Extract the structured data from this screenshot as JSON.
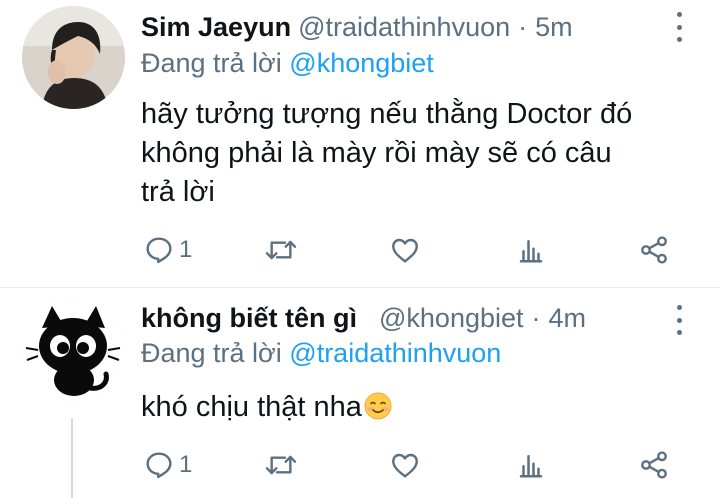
{
  "tweets": [
    {
      "name": "Sim Jaeyun",
      "handle": "@traidathinhvuon",
      "dot": "·",
      "time": "5m",
      "reply_prefix": "Đang trả lời",
      "reply_mention": "@khongbiet",
      "lines": [
        "hãy tưởng tượng nếu thằng Doctor đó",
        "không phải là mày rồi mày sẽ có câu",
        "trả lời"
      ],
      "reply_count": "1"
    },
    {
      "name": "không biết tên gì",
      "handle": "@khongbiet",
      "dot": "·",
      "time": "4m",
      "reply_prefix": "Đang trả lời",
      "reply_mention": "@traidathinhvuon",
      "lines": [
        "khó chịu thật nha"
      ],
      "reply_count": "1"
    }
  ],
  "icons": {
    "reply": "reply-icon",
    "retweet": "retweet-icon",
    "like": "heart-icon",
    "analytics": "analytics-icon",
    "share": "share-icon",
    "more": "more-vertical-icon",
    "emoji": "smiling-face-emoji"
  },
  "colors": {
    "accent": "#1da1f2",
    "secondary_text": "#5b7083",
    "divider": "#e6ecf0"
  }
}
